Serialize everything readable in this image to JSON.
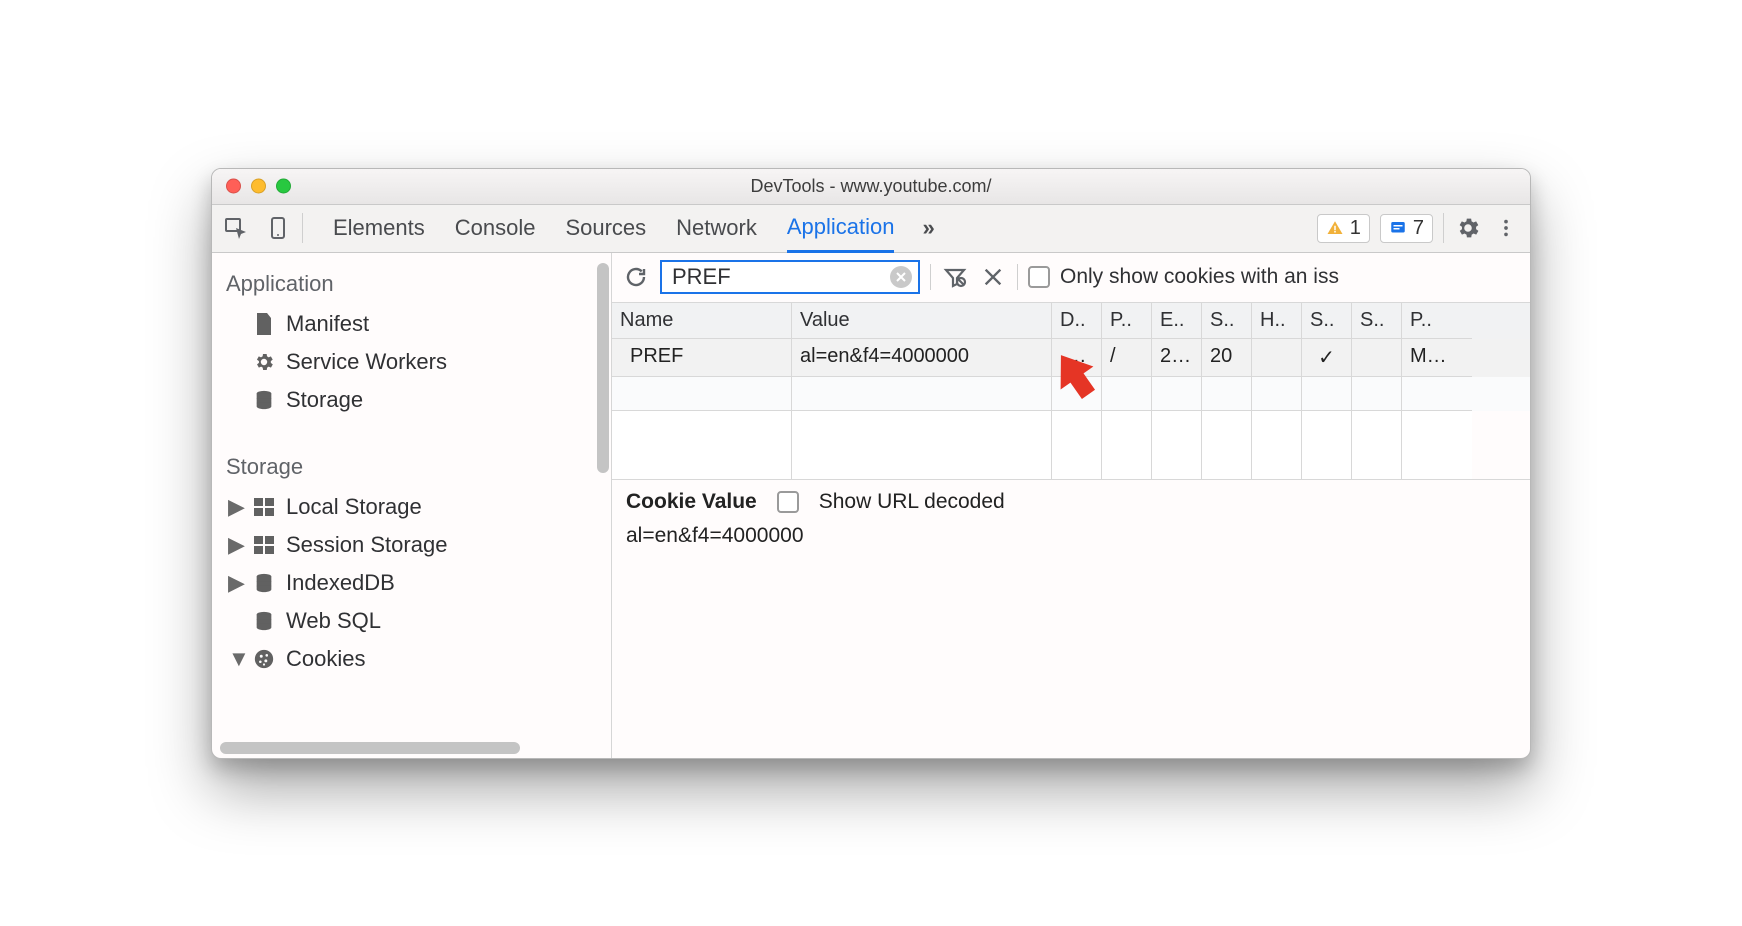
{
  "window": {
    "title": "DevTools - www.youtube.com/"
  },
  "toolbar": {
    "tabs": [
      "Elements",
      "Console",
      "Sources",
      "Network",
      "Application"
    ],
    "active_tab_index": 4,
    "overflow_label": "»",
    "warn_count": "1",
    "info_count": "7"
  },
  "sidebar": {
    "groups": [
      {
        "heading": "Application",
        "items": [
          {
            "label": "Manifest",
            "icon": "file-icon",
            "disclosure": ""
          },
          {
            "label": "Service Workers",
            "icon": "gear-icon",
            "disclosure": ""
          },
          {
            "label": "Storage",
            "icon": "database-icon",
            "disclosure": ""
          }
        ]
      },
      {
        "heading": "Storage",
        "items": [
          {
            "label": "Local Storage",
            "icon": "grid-icon",
            "disclosure": "▶"
          },
          {
            "label": "Session Storage",
            "icon": "grid-icon",
            "disclosure": "▶"
          },
          {
            "label": "IndexedDB",
            "icon": "database-icon",
            "disclosure": "▶"
          },
          {
            "label": "Web SQL",
            "icon": "database-icon",
            "disclosure": ""
          },
          {
            "label": "Cookies",
            "icon": "cookie-icon",
            "disclosure": "▼"
          }
        ]
      }
    ]
  },
  "cookies": {
    "filter_value": "PREF",
    "issue_label": "Only show cookies with an iss",
    "columns": [
      "Name",
      "Value",
      "D..",
      "P..",
      "E..",
      "S..",
      "H..",
      "S..",
      "S..",
      "P.."
    ],
    "rows": [
      {
        "name": "PREF",
        "value": "al=en&f4=4000000",
        "d": "….",
        "p": "/",
        "e": "2…",
        "s": "20",
        "h": "",
        "sec": "✓",
        "ss": "",
        "pr": "M…"
      }
    ],
    "detail": {
      "title": "Cookie Value",
      "decode_label": "Show URL decoded",
      "value": "al=en&f4=4000000"
    }
  }
}
